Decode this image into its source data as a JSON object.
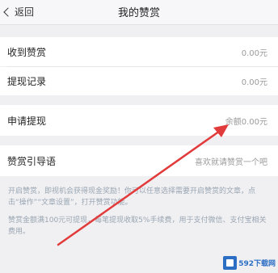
{
  "nav": {
    "back_label": "返回",
    "title": "我的赞赏"
  },
  "rows": {
    "received": {
      "label": "收到赞赏",
      "value": "0.00元"
    },
    "withdraw_records": {
      "label": "提现记录",
      "value": "0.00元"
    },
    "apply_withdraw": {
      "label": "申请提现",
      "value": "余额0.00元"
    },
    "guide": {
      "label": "赞赏引导语",
      "value": "喜欢就请赞赏一个吧"
    }
  },
  "notes": {
    "p1": "开启赞赏，即视机会获得现金奖励！你可以任意选择需要开启赞赏的文章，点击“操作”“文章设置”，打开赞赏功能。",
    "p2": "赞赏金额满100元可提现，每笔提现收取5%手续费，用于支付微信、支付宝相关费用。"
  },
  "watermark": {
    "text": "592下载网"
  },
  "colors": {
    "arrow": "#e23b3b",
    "background": "#f0f0f3"
  }
}
